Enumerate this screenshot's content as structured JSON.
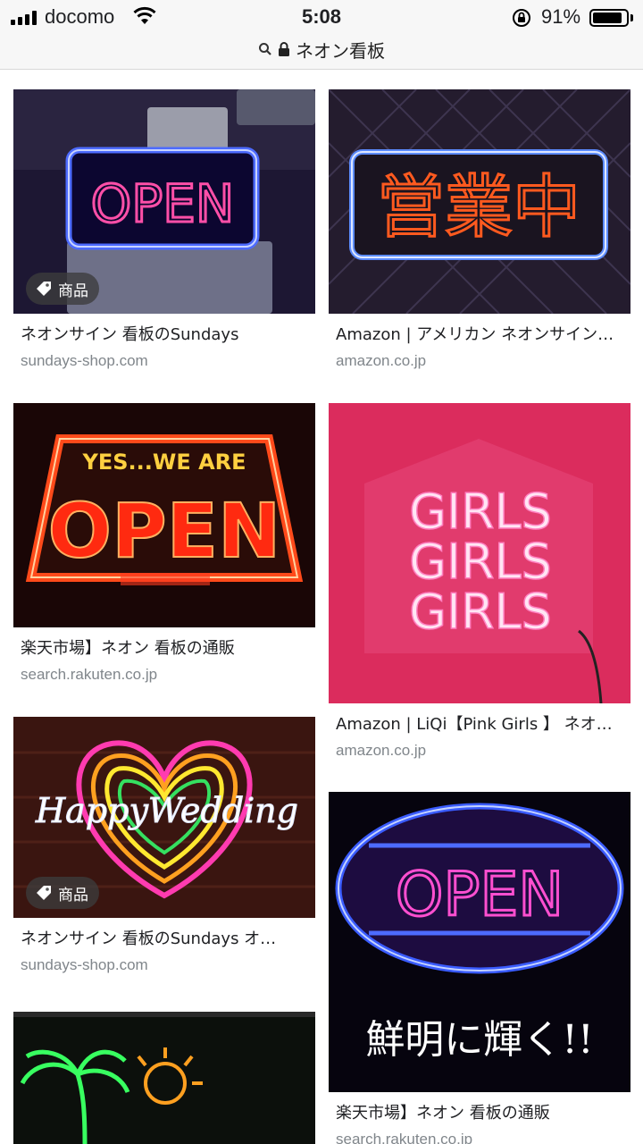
{
  "status_bar": {
    "carrier": "docomo",
    "time": "5:08",
    "battery_percent": "91%",
    "battery_level": 0.91
  },
  "address_bar": {
    "query": "ネオン看板"
  },
  "results": [
    {
      "title": "ネオンサイン 看板のSundays",
      "domain": "sundays-shop.com",
      "badge": "商品",
      "image_text": "OPEN"
    },
    {
      "title": "Amazon | アメリカン ネオンサイン…",
      "domain": "amazon.co.jp",
      "image_text": "営業中"
    },
    {
      "title": "楽天市場】ネオン 看板の通販",
      "domain": "search.rakuten.co.jp",
      "image_text_top": "YES...WE ARE",
      "image_text": "OPEN"
    },
    {
      "title": "Amazon | LiQi【Pink Girls 】 ネオ…",
      "domain": "amazon.co.jp",
      "image_text": "GIRLS"
    },
    {
      "title": "ネオンサイン 看板のSundays オ…",
      "domain": "sundays-shop.com",
      "badge": "商品",
      "image_text": "HappyWedding"
    },
    {
      "title": "楽天市場】ネオン 看板の通販",
      "domain": "search.rakuten.co.jp",
      "image_text": "OPEN",
      "image_caption": "鮮明に輝く!!"
    },
    {
      "title": "",
      "domain": ""
    }
  ],
  "colors": {
    "neon_blue": "#4d6bff",
    "neon_pink": "#ff4fa8",
    "neon_red": "#ff3b1f",
    "neon_orange": "#ffb020"
  }
}
